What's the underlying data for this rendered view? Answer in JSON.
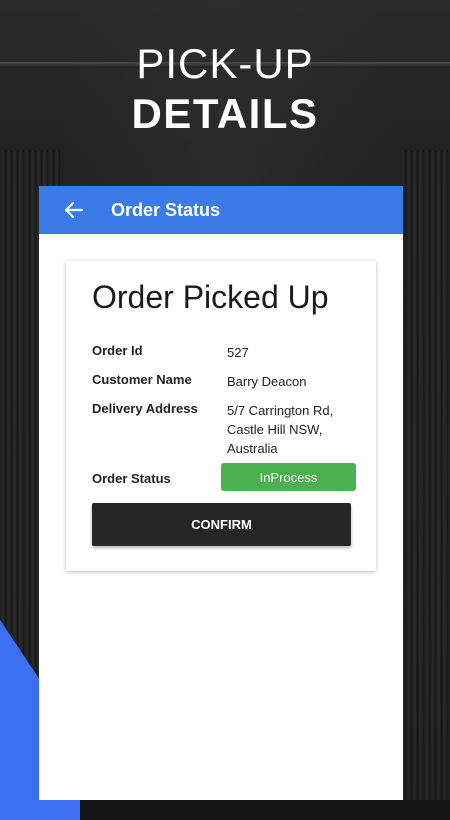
{
  "hero": {
    "line1": "PICK-UP",
    "line2": "DETAILS"
  },
  "appbar": {
    "title": "Order Status",
    "back_icon": "arrow-left-icon"
  },
  "card": {
    "title": "Order Picked Up",
    "order_id_label": "Order Id",
    "order_id_value": "527",
    "customer_name_label": "Customer Name",
    "customer_name_value": "Barry Deacon",
    "delivery_address_label": "Delivery Address",
    "delivery_address_lines": [
      "5/7 Carrington Rd,",
      "Castle Hill NSW,",
      "Australia"
    ],
    "order_status_label": "Order Status",
    "order_status_value": "InProcess",
    "confirm_label": "CONFIRM"
  },
  "colors": {
    "appbar": "#3b7be8",
    "status_pill": "#4caf50",
    "confirm_button": "#262626",
    "accent_corner": "#3d6ff2"
  }
}
